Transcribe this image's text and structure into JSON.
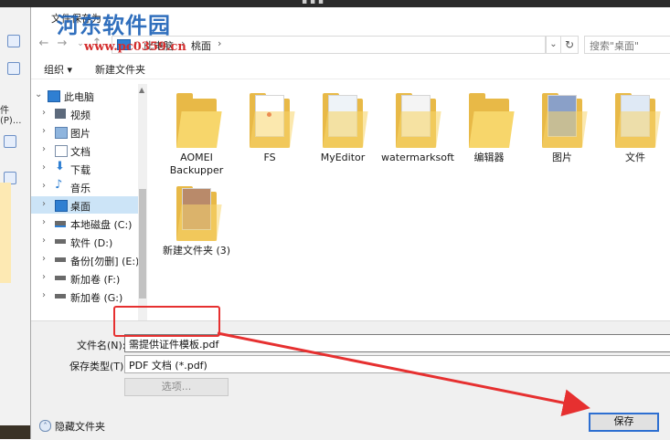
{
  "dialog": {
    "title": "文件保存为"
  },
  "watermark": {
    "brand": "河东软件园",
    "url": "www.pc0359.cn"
  },
  "background_app": {
    "menu_fragment": "件(P)..."
  },
  "nav": {
    "back_icon": "arrow-left-icon",
    "forward_icon": "arrow-right-icon",
    "up_icon": "arrow-up-icon",
    "path": [
      "此电脑",
      "桃面"
    ],
    "search_placeholder": "搜索\"桌面\""
  },
  "toolbar": {
    "organize_label": "组织 ▾",
    "new_folder_label": "新建文件夹"
  },
  "tree": [
    {
      "label": "此电脑",
      "expanded": true,
      "icon": "computer-icon"
    },
    {
      "label": "视频",
      "icon": "video-icon"
    },
    {
      "label": "图片",
      "icon": "picture-icon"
    },
    {
      "label": "文档",
      "icon": "document-icon"
    },
    {
      "label": "下载",
      "icon": "download-icon"
    },
    {
      "label": "音乐",
      "icon": "music-icon"
    },
    {
      "label": "桌面",
      "icon": "desktop-icon",
      "selected": true
    },
    {
      "label": "本地磁盘 (C:)",
      "icon": "drive-icon"
    },
    {
      "label": "软件 (D:)",
      "icon": "drive-icon"
    },
    {
      "label": "备份[勿删] (E:)",
      "icon": "drive-icon"
    },
    {
      "label": "新加卷 (F:)",
      "icon": "drive-icon"
    },
    {
      "label": "新加卷 (G:)",
      "icon": "drive-icon"
    }
  ],
  "files": [
    {
      "name": "AOMEI Backupper"
    },
    {
      "name": "FS"
    },
    {
      "name": "MyEditor"
    },
    {
      "name": "watermarksoft"
    },
    {
      "name": "编辑器"
    },
    {
      "name": "图片"
    },
    {
      "name": "文件"
    },
    {
      "name": "新建文件夹 (3)"
    }
  ],
  "form": {
    "filename_label": "文件名(N):",
    "filename_value": "需提供证件模板.pdf",
    "filetype_label": "保存类型(T):",
    "filetype_value": "PDF 文档 (*.pdf)",
    "options_label": "选项...",
    "hide_folders_label": "隐藏文件夹",
    "save_label": "保存"
  },
  "colors": {
    "annotation_red": "#e63030",
    "selection_blue": "#cce4f7",
    "folder_yellow": "#e8b947"
  }
}
